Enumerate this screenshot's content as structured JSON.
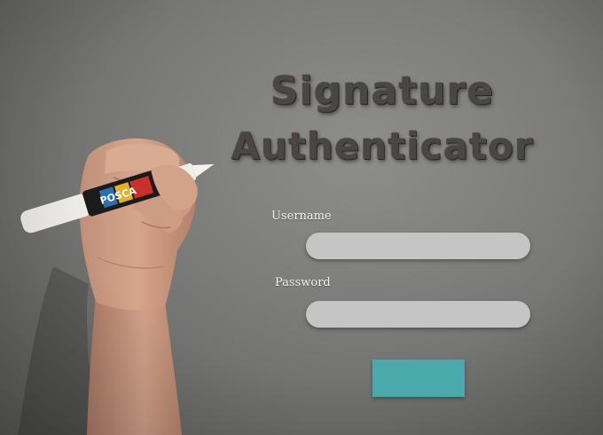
{
  "header": {
    "title_line1": "Signature",
    "title_line2": "Authenticator"
  },
  "form": {
    "username_label": "Username",
    "username_value": "",
    "password_label": "Password",
    "password_value": "",
    "submit_label": ""
  },
  "colors": {
    "background": "#7e7e7c",
    "title_text": "#4a4646",
    "field_fill": "#c5c5c5",
    "submit_button": "#4aa9aa"
  },
  "background_image": {
    "subject": "hand-holding-posca-marker",
    "marker_brand_text": "POSCA"
  }
}
